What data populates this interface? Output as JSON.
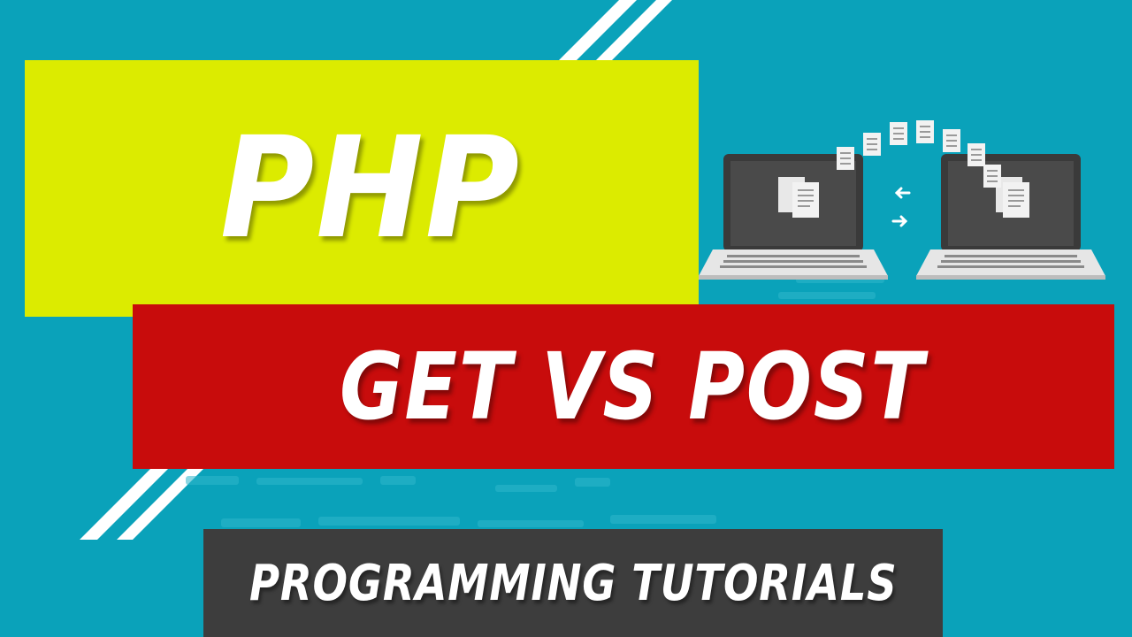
{
  "thumbnail": {
    "title": "PHP",
    "subtitle": "GET VS POST",
    "banner": "PROGRAMMING TUTORIALS"
  },
  "illustration": {
    "icon": "file-transfer-laptops-icon"
  },
  "colors": {
    "background": "#0aa2ba",
    "title_panel": "#dceb00",
    "subtitle_panel": "#c80c0c",
    "banner_panel": "#3d3d3d",
    "text": "#ffffff",
    "stripes": "#ffffff"
  }
}
